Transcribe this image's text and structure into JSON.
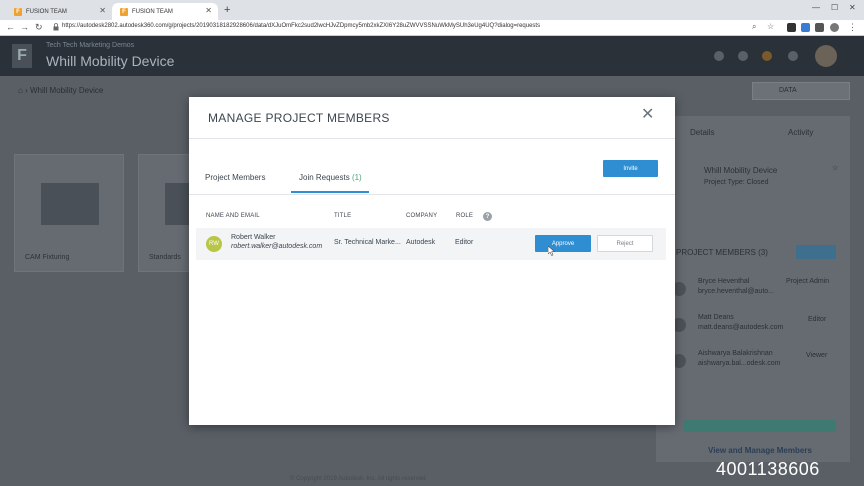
{
  "browser": {
    "tabs": [
      {
        "label": "FUSION TEAM",
        "active": false
      },
      {
        "label": "FUSION TEAM",
        "active": true
      }
    ],
    "url": "https://autodesk2802.autodesk360.com/g/projects/20190318182928606/data/dXJuOmFkc2sud2lwcHJvZDpmcy5mb2xkZXI6Y28uZWVVSSNuWkMySUh3eUg4UQ?dialog=requests"
  },
  "app": {
    "hub_name": "Tech Tech Marketing Demos",
    "project_title": "Whill Mobility Device",
    "brand_color": "#2f8ed2"
  },
  "background": {
    "breadcrumb": "Whill Mobility Device",
    "data_selector": "DATA",
    "folders": [
      "CAM Fixturing",
      "Standards"
    ],
    "right_panel": {
      "tabs": [
        "Details",
        "Activity"
      ],
      "project_name": "Whill Mobility Device",
      "project_type": "Project Type: Closed",
      "section_title": "PROJECT MEMBERS (3)",
      "members": [
        {
          "name": "Bryce Heventhal",
          "email": "bryce.heventhal@auto...",
          "role": "Project Admin"
        },
        {
          "name": "Matt Deans",
          "email": "matt.deans@autodesk.com",
          "role": "Editor"
        },
        {
          "name": "Aishwarya Balakrishnan",
          "email": "aishwarya.bal...odesk.com",
          "role": "Viewer"
        }
      ],
      "manage_link": "View and Manage Members"
    },
    "footer": "© Copyright 2019 Autodesk, Inc. All rights reserved."
  },
  "modal": {
    "title": "MANAGE PROJECT MEMBERS",
    "tabs": [
      {
        "label": "Project Members"
      },
      {
        "label": "Join Requests",
        "count": "(1)"
      }
    ],
    "invite_label": "Invite",
    "columns": {
      "name_email": "NAME AND EMAIL",
      "title": "TITLE",
      "company": "COMPANY",
      "role": "ROLE"
    },
    "help_icon": "?",
    "requests": [
      {
        "initials": "RW",
        "name": "Robert Walker",
        "email": "robert.walker@autodesk.com",
        "title": "Sr. Technical Marke...",
        "company": "Autodesk",
        "role": "Editor",
        "approve_label": "Approve",
        "reject_label": "Reject"
      }
    ]
  },
  "watermark": "4001138606"
}
